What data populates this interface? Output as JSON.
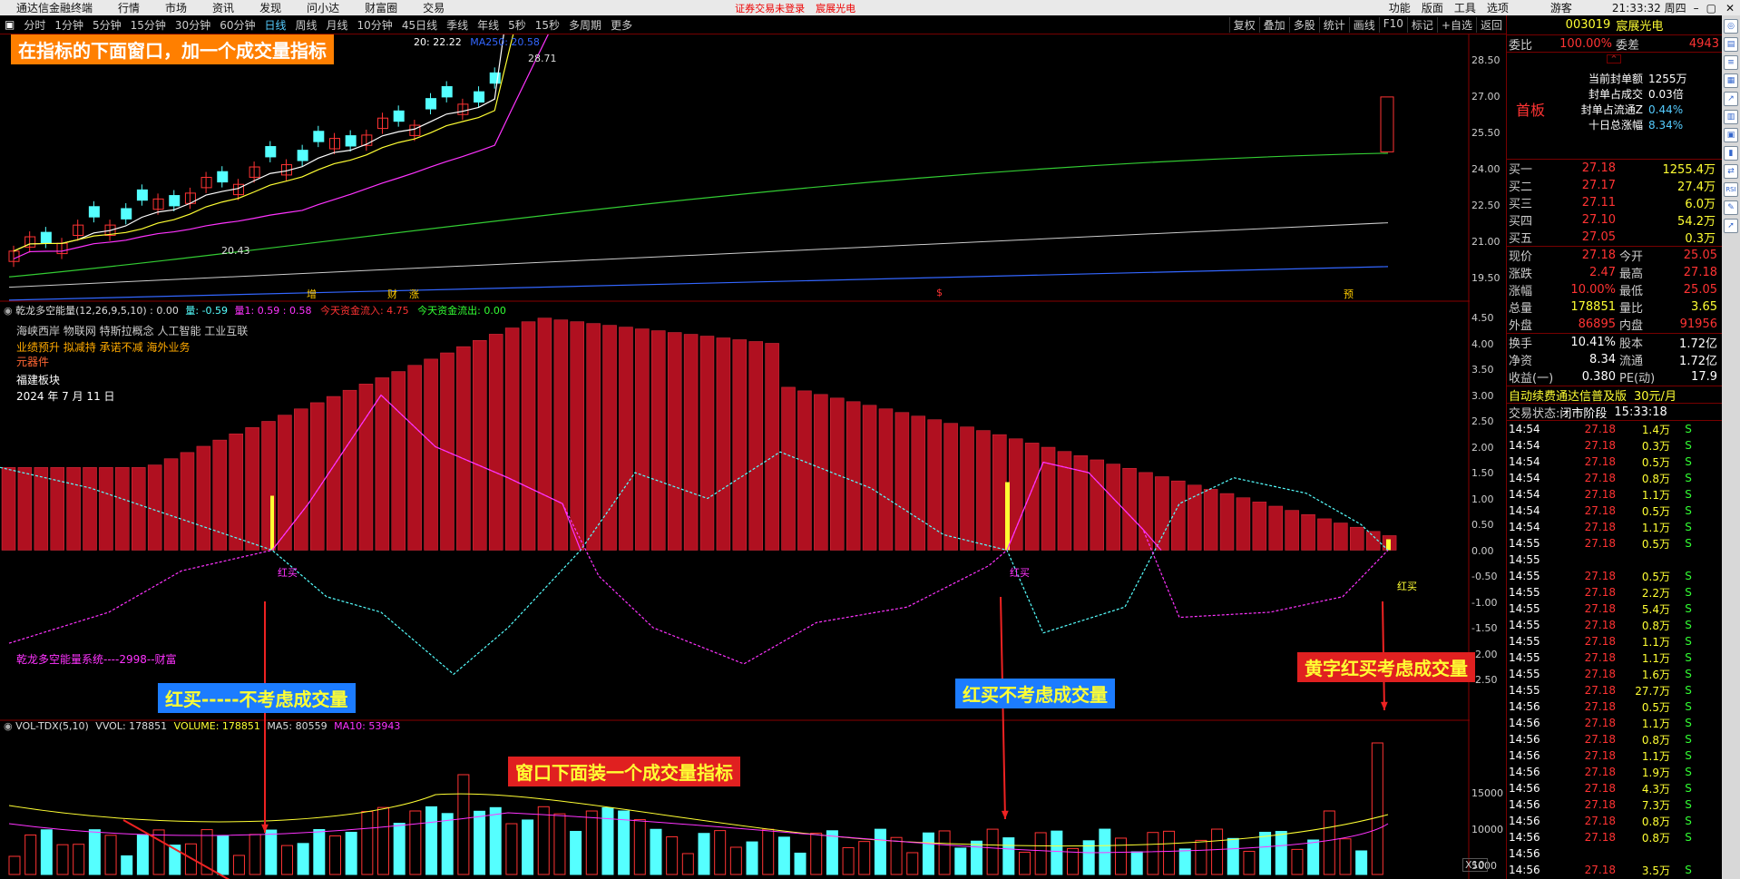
{
  "menubar": {
    "app_title": "通达信金融终端",
    "items": [
      "行情",
      "市场",
      "资讯",
      "发现",
      "问小达",
      "财富圈",
      "交易"
    ],
    "alert1": "证券交易未登录",
    "alert2": "宸展光电",
    "right_items": [
      "功能",
      "版面",
      "工具",
      "选项"
    ],
    "user": "游客",
    "time": "21:33:32 周四"
  },
  "periods": [
    "分时",
    "1分钟",
    "5分钟",
    "15分钟",
    "30分钟",
    "60分钟",
    "日线",
    "周线",
    "月线",
    "10分钟",
    "45日线",
    "季线",
    "年线",
    "5秒",
    "15秒",
    "多周期",
    "更多"
  ],
  "active_period": "日线",
  "tools": [
    "复权",
    "叠加",
    "多股",
    "统计",
    "画线",
    "F10",
    "标记",
    "+自选",
    "返回"
  ],
  "stock": {
    "code": "003019",
    "name": "宸展光电"
  },
  "weibi": {
    "label": "委比",
    "value": "100.00%",
    "label2": "委差",
    "value2": "4943"
  },
  "board": {
    "label": "首板",
    "items": [
      {
        "k": "当前封单额",
        "v": "1255万"
      },
      {
        "k": "封单占成交",
        "v": "0.03倍"
      },
      {
        "k": "封单占流通Z",
        "v": "0.44%"
      },
      {
        "k": "十日总涨幅",
        "v": "8.34%"
      }
    ]
  },
  "bids": [
    {
      "l": "买一",
      "p": "27.18",
      "v": "1255.4万"
    },
    {
      "l": "买二",
      "p": "27.17",
      "v": "27.4万"
    },
    {
      "l": "买三",
      "p": "27.11",
      "v": "6.0万"
    },
    {
      "l": "买四",
      "p": "27.10",
      "v": "54.2万"
    },
    {
      "l": "买五",
      "p": "27.05",
      "v": "0.3万"
    }
  ],
  "quote": [
    {
      "a": "现价",
      "b": "27.18",
      "c": "今开",
      "d": "25.05"
    },
    {
      "a": "涨跌",
      "b": "2.47",
      "c": "最高",
      "d": "27.18"
    },
    {
      "a": "涨幅",
      "b": "10.00%",
      "c": "最低",
      "d": "25.05"
    },
    {
      "a": "总量",
      "b": "178851",
      "c": "量比",
      "d": "3.65"
    },
    {
      "a": "外盘",
      "b": "86895",
      "c": "内盘",
      "d": "91956"
    }
  ],
  "fund": [
    {
      "a": "换手",
      "b": "10.41%",
      "c": "股本",
      "d": "1.72亿"
    },
    {
      "a": "净资",
      "b": "8.34",
      "c": "流通",
      "d": "1.72亿"
    },
    {
      "a": "收益(一)",
      "b": "0.380",
      "c": "PE(动)",
      "d": "17.9"
    }
  ],
  "ad": {
    "text": "自动续费通达信普及版",
    "price": "30元/月"
  },
  "trade_state": {
    "label": "交易状态:",
    "state": "闭市阶段",
    "time": "15:33:18"
  },
  "ticks": [
    [
      "14:54",
      "27.18",
      "1.4万",
      "S"
    ],
    [
      "14:54",
      "27.18",
      "0.3万",
      "S"
    ],
    [
      "14:54",
      "27.18",
      "0.5万",
      "S"
    ],
    [
      "14:54",
      "27.18",
      "0.8万",
      "S"
    ],
    [
      "14:54",
      "27.18",
      "1.1万",
      "S"
    ],
    [
      "14:54",
      "27.18",
      "0.5万",
      "S"
    ],
    [
      "14:54",
      "27.18",
      "1.1万",
      "S"
    ],
    [
      "14:55",
      "27.18",
      "0.5万",
      "S"
    ],
    [
      "14:55",
      "",
      "",
      ""
    ],
    [
      "14:55",
      "27.18",
      "0.5万",
      "S"
    ],
    [
      "14:55",
      "27.18",
      "2.2万",
      "S"
    ],
    [
      "14:55",
      "27.18",
      "5.4万",
      "S"
    ],
    [
      "14:55",
      "27.18",
      "0.8万",
      "S"
    ],
    [
      "14:55",
      "27.18",
      "1.1万",
      "S"
    ],
    [
      "14:55",
      "27.18",
      "1.1万",
      "S"
    ],
    [
      "14:55",
      "27.18",
      "1.6万",
      "S"
    ],
    [
      "14:55",
      "27.18",
      "27.7万",
      "S"
    ],
    [
      "14:56",
      "27.18",
      "0.5万",
      "S"
    ],
    [
      "14:56",
      "27.18",
      "1.1万",
      "S"
    ],
    [
      "14:56",
      "27.18",
      "0.8万",
      "S"
    ],
    [
      "14:56",
      "27.18",
      "1.1万",
      "S"
    ],
    [
      "14:56",
      "27.18",
      "1.9万",
      "S"
    ],
    [
      "14:56",
      "27.18",
      "4.3万",
      "S"
    ],
    [
      "14:56",
      "27.18",
      "7.3万",
      "S"
    ],
    [
      "14:56",
      "27.18",
      "0.8万",
      "S"
    ],
    [
      "14:56",
      "27.18",
      "0.8万",
      "S"
    ],
    [
      "14:56",
      "",
      "",
      " "
    ],
    [
      "14:56",
      "27.18",
      "3.5万",
      "S"
    ]
  ],
  "main_chart": {
    "ma_text": "20: 22.22",
    "ma250": "MA250: 20.58",
    "high_label": "28.71",
    "low_label": "20.43",
    "y_ticks": [
      "28.50",
      "27.00",
      "25.50",
      "24.00",
      "22.50",
      "21.00",
      "19.50"
    ],
    "markers": [
      "增",
      "财",
      "涨",
      "$",
      "预"
    ]
  },
  "indicator": {
    "title": "乾龙多空能量(12,26,9,5,10)",
    "v0": ": 0.00",
    "v1": "量: -0.59",
    "v2": "量1: 0.59",
    "v3": ": 0.58",
    "inflow": "今天资金流入: 4.75",
    "outflow": "今天资金流出: 0.00",
    "concepts": "海峡西岸 物联网 特斯拉概念 人工智能 工业互联",
    "concepts2": "业绩预升 拟减持 承诺不减 海外业务",
    "concepts3": "元器件",
    "region": "福建板块",
    "date": "2024 年 7 月 11 日",
    "system_name": "乾龙多空能量系统----2998--财富",
    "buy_label": "红买",
    "y_ticks": [
      "4.50",
      "4.00",
      "3.50",
      "3.00",
      "2.50",
      "2.00",
      "1.50",
      "1.00",
      "0.50",
      "0.00",
      "-0.50",
      "-1.00",
      "-1.50",
      "-2.00",
      "-2.50"
    ]
  },
  "volume": {
    "title": "VOL-TDX(5,10)",
    "vvol": "VVOL: 178851",
    "volume": "VOLUME: 178851",
    "ma5": "MA5: 80559",
    "ma10": "MA10: 53943",
    "y_ticks": [
      "15000",
      "10000",
      "5000"
    ],
    "unit": "X10"
  },
  "annotations": {
    "top": "在指标的下面窗口，加一个成交量指标",
    "left": "红买-----不考虑成交量",
    "mid": "红买不考虑成交量",
    "right": "黄字红买考虑成交量",
    "vol": "窗口下面装一个成交量指标"
  },
  "icon_names": [
    "watch-icon",
    "chart-icon",
    "list-icon",
    "news-icon",
    "rsi-icon"
  ],
  "colors": {
    "up": "#ff3333",
    "down": "#55ffff",
    "accent": "#ff8800"
  }
}
